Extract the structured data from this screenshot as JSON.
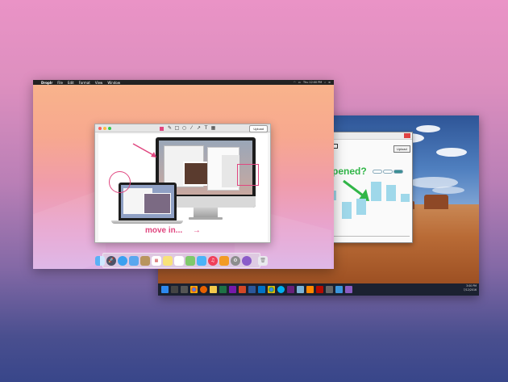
{
  "mac": {
    "menubar": {
      "app_name": "Droplr",
      "menus": [
        "File",
        "Edit",
        "Format",
        "View",
        "Window"
      ],
      "clock": "Thu 12:00 PM"
    },
    "droplr_window": {
      "upload_label": "Upload",
      "annotation_text": "move in...",
      "arrow_glyph": "→"
    },
    "dock": {
      "icons": [
        "finder-icon",
        "launchpad-icon",
        "safari-icon",
        "mail-icon",
        "contacts-icon",
        "calendar-icon",
        "notes-icon",
        "reminders-icon",
        "maps-icon",
        "messages-icon",
        "itunes-icon",
        "ibooks-icon",
        "system-preferences-icon",
        "droplr-icon",
        "trash-icon"
      ]
    },
    "colors": {
      "accent": "#e0467f"
    }
  },
  "windows": {
    "app_window": {
      "upload_label": "Upload",
      "headline": "pened?",
      "pill_labels": [
        "",
        "",
        ""
      ],
      "bar_labels": [
        "",
        "",
        "",
        "",
        "",
        "",
        "",
        ""
      ]
    },
    "taskbar": {
      "clock_time": "3:00 PM",
      "clock_date": "7/12/2016",
      "icons": [
        "start-icon",
        "search-icon",
        "task-view-icon",
        "chrome-icon",
        "firefox-icon",
        "explorer-icon",
        "excel-icon",
        "onenote-icon",
        "powerpoint-icon",
        "word-icon",
        "outlook-icon",
        "chrome-icon",
        "skype-icon",
        "visual-studio-icon",
        "notepad-icon",
        "vlc-icon",
        "acrobat-icon",
        "calculator-icon",
        "paint-icon",
        "settings-icon"
      ]
    },
    "colors": {
      "highlight": "#31b648"
    }
  }
}
